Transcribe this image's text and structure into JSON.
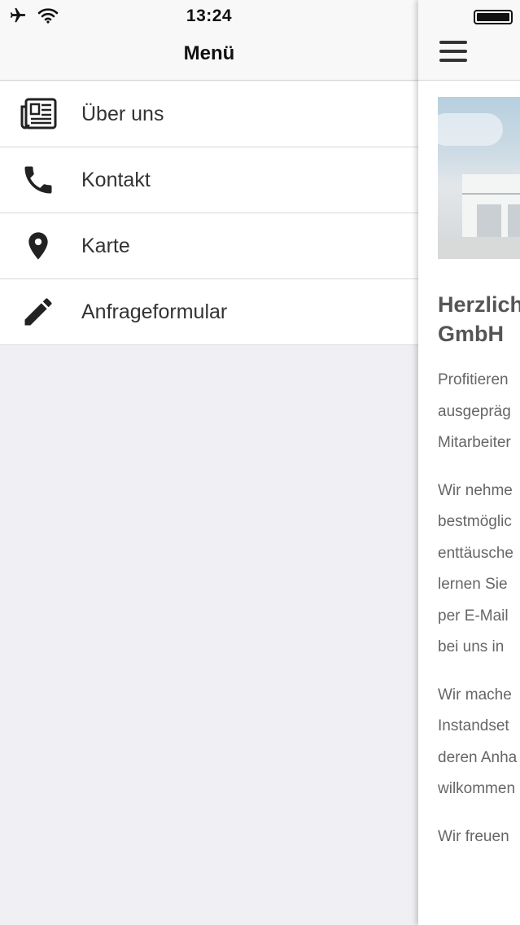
{
  "status_bar": {
    "time": "13:24",
    "airplane_icon": "airplane-icon",
    "wifi_icon": "wifi-icon",
    "battery_icon": "battery-icon"
  },
  "drawer": {
    "title": "Menü",
    "items": [
      {
        "label": "Über uns",
        "icon": "newspaper-icon"
      },
      {
        "label": "Kontakt",
        "icon": "phone-icon"
      },
      {
        "label": "Karte",
        "icon": "map-pin-icon"
      },
      {
        "label": "Anfrageformular",
        "icon": "pencil-icon"
      }
    ]
  },
  "main": {
    "menu_icon": "hamburger-menu-icon",
    "heading": "Herzlich\nGmbH",
    "paragraphs": [
      "Profitieren\nausgepräg\nMitarbeiter",
      "Wir nehme\nbestmöglic\nenttäusche\nlernen Sie\nper E-Mail\nbei uns in",
      "Wir mache\nInstandset\nderen Anha\nwilkommen",
      "Wir freuen"
    ]
  },
  "colors": {
    "header_bg": "#f8f8f8",
    "drawer_bg": "#efeff4",
    "text_dark": "#333333",
    "text_body": "#666666"
  }
}
